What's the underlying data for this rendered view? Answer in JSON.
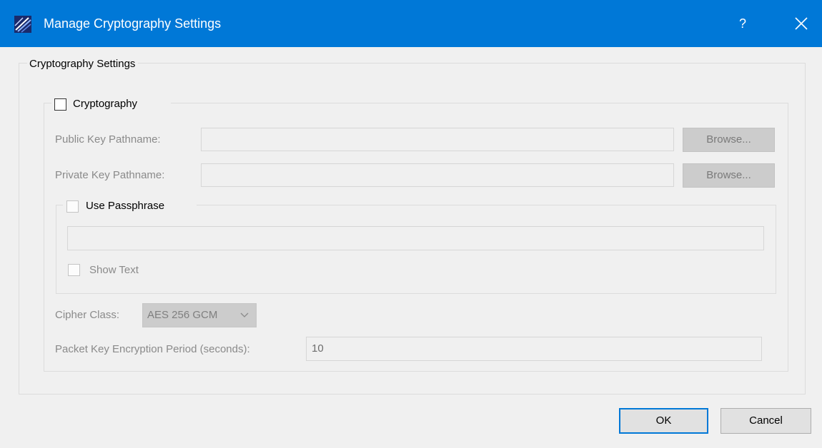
{
  "window": {
    "title": "Manage Cryptography Settings",
    "help_label": "?",
    "accent_color": "#0078d7"
  },
  "settings_group": {
    "legend": "Cryptography Settings"
  },
  "crypto_group": {
    "enable_label": "Cryptography",
    "enabled": false,
    "public_key": {
      "label": "Public Key Pathname:",
      "value": "",
      "browse_label": "Browse..."
    },
    "private_key": {
      "label": "Private Key Pathname:",
      "value": "",
      "browse_label": "Browse..."
    },
    "passphrase": {
      "enable_label": "Use Passphrase",
      "enabled": false,
      "value": "",
      "show_text_label": "Show Text",
      "show_text_checked": false
    },
    "cipher_class": {
      "label": "Cipher Class:",
      "value": "AES 256 GCM"
    },
    "packet_key_period": {
      "label": "Packet Key Encryption Period (seconds):",
      "value": "10"
    }
  },
  "footer": {
    "ok_label": "OK",
    "cancel_label": "Cancel"
  }
}
